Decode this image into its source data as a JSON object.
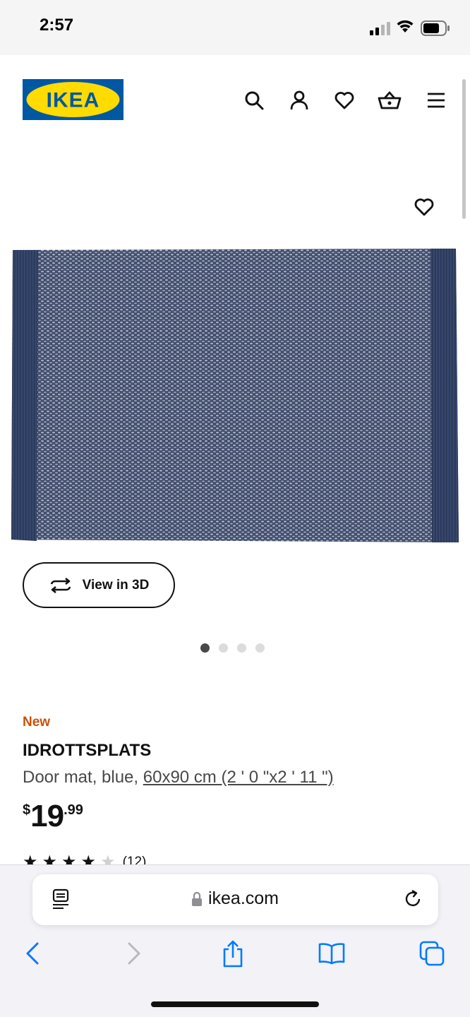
{
  "status_bar": {
    "time": "2:57"
  },
  "header": {
    "logo_text": "IKEA",
    "icons": [
      "search-icon",
      "account-icon",
      "favorites-icon",
      "cart-icon",
      "menu-icon"
    ]
  },
  "product": {
    "image_icon": "heart-icon",
    "view_3d_label": "View in 3D",
    "carousel": {
      "total": 4,
      "active": 1
    },
    "badge": "New",
    "name": "IDROTTSPLATS",
    "description_prefix": "Door mat, blue, ",
    "size_link": "60x90 cm (2 ' 0 \"x2 ' 11 \")",
    "price": {
      "currency": "$",
      "integer": "19",
      "decimal": ".99"
    },
    "rating": {
      "stars": 4,
      "count": "(12)"
    }
  },
  "browser": {
    "url": "ikea.com",
    "buttons": [
      "back-icon",
      "forward-icon",
      "share-icon",
      "bookmarks-icon",
      "tabs-icon"
    ]
  },
  "colors": {
    "ikea_blue": "#0058a3",
    "ikea_yellow": "#ffdb00",
    "new_badge": "#ca5008",
    "ios_blue": "#007aff",
    "mat_blue": "#2c3a5c"
  }
}
